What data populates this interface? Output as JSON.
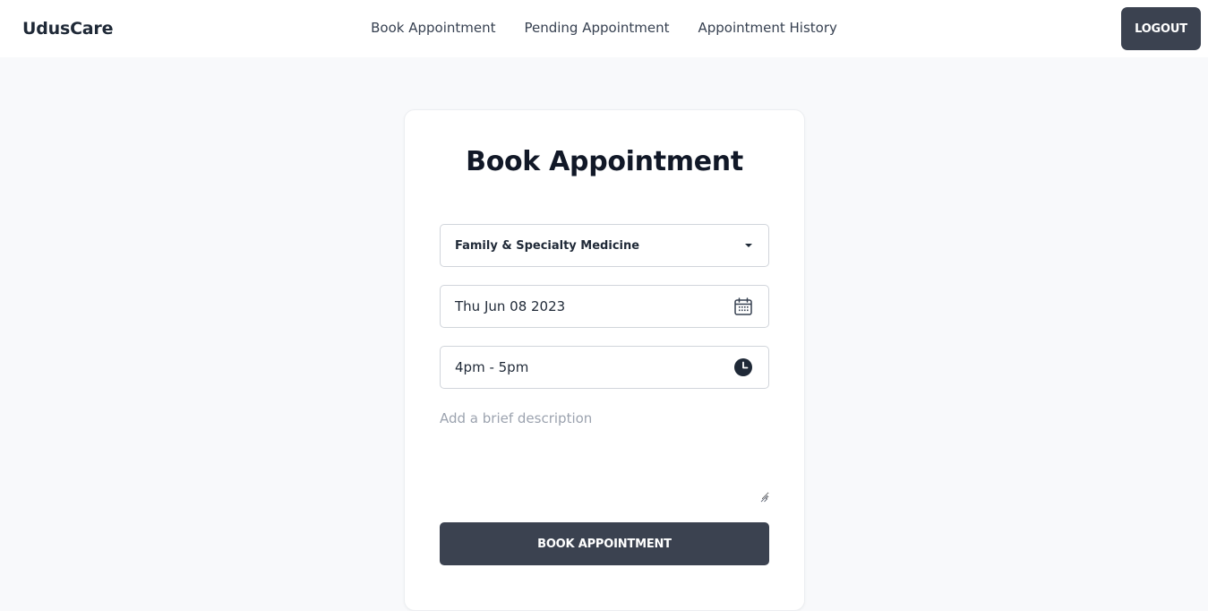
{
  "header": {
    "brand": "UdusCare",
    "nav": [
      {
        "label": "Book Appointment"
      },
      {
        "label": "Pending Appointment"
      },
      {
        "label": "Appointment History"
      }
    ],
    "logout_label": "LOGOUT"
  },
  "form": {
    "title": "Book Appointment",
    "specialty": {
      "value": "Family & Specialty Medicine",
      "icon": "caret-down-icon"
    },
    "date": {
      "value": "Thu Jun 08 2023",
      "icon": "calendar-icon"
    },
    "time": {
      "value": "4pm - 5pm",
      "icon": "clock-icon"
    },
    "description": {
      "placeholder": "Add a brief description",
      "value": ""
    },
    "submit_label": "BOOK APPOINTMENT"
  },
  "colors": {
    "background": "#f8f9fb",
    "button": "#3b4250",
    "text": "#1f2937"
  }
}
